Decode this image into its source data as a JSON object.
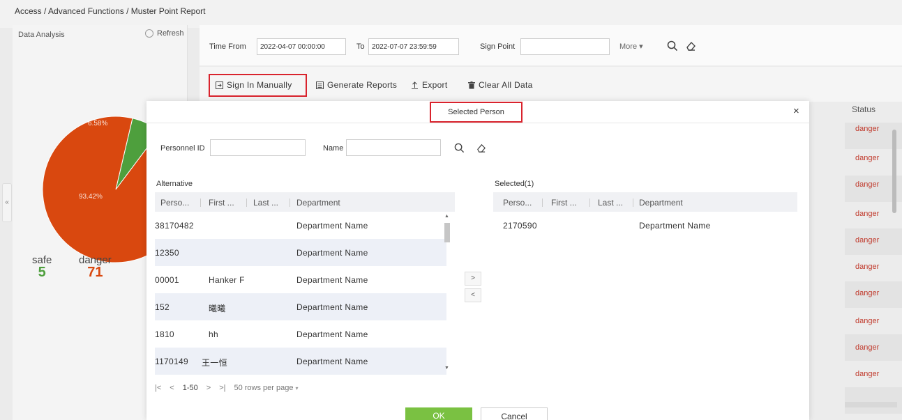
{
  "breadcrumb": "Access / Advanced Functions / Muster Point Report",
  "left_panel": {
    "title": "Data Analysis",
    "refresh_label": "Refresh",
    "pie": {
      "slices": [
        {
          "label": "6.58%",
          "value": 6.58,
          "color": "#4e9f3d"
        },
        {
          "label": "93.42%",
          "value": 93.42,
          "color": "#d9480f"
        }
      ]
    },
    "legend": [
      {
        "label": "safe",
        "value": "5",
        "color": "#4e9f3d"
      },
      {
        "label": "danger",
        "value": "71",
        "color": "#d9480f"
      }
    ],
    "collapse_glyph": "«"
  },
  "filters": {
    "time_from_label": "Time From",
    "time_from_value": "2022-04-07 00:00:00",
    "to_label": "To",
    "to_value": "2022-07-07 23:59:59",
    "sign_point_label": "Sign Point",
    "sign_point_value": "",
    "more_label": "More ▾"
  },
  "toolbar": {
    "sign_in_label": "Sign In Manually",
    "generate_label": "Generate Reports",
    "export_label": "Export",
    "clear_label": "Clear All Data"
  },
  "status_column": {
    "header": "Status",
    "values": [
      "danger",
      "danger",
      "danger",
      "danger",
      "danger",
      "danger",
      "danger",
      "danger",
      "danger",
      "danger"
    ]
  },
  "dialog": {
    "title": "Selected Person",
    "close_glyph": "×",
    "personnel_id_label": "Personnel ID",
    "personnel_id_value": "",
    "name_label": "Name",
    "name_value": "",
    "alternative_label": "Alternative",
    "selected_label": "Selected(1)",
    "columns": [
      "Perso...",
      "First ...",
      "Last ...",
      "Department"
    ],
    "alternative_rows": [
      {
        "id": "38170482",
        "first": "",
        "last": "",
        "dept": "Department Name"
      },
      {
        "id": "12350",
        "first": "",
        "last": "",
        "dept": "Department Name"
      },
      {
        "id": "00001",
        "first": "Hanker F",
        "last": "",
        "dept": "Department Name"
      },
      {
        "id": "152",
        "first": "曦曦",
        "last": "",
        "dept": "Department Name"
      },
      {
        "id": "1810",
        "first": "hh",
        "last": "",
        "dept": "Department Name"
      },
      {
        "id": "1170149",
        "first": "王一恒",
        "last": "",
        "dept": "Department Name"
      }
    ],
    "selected_rows": [
      {
        "id": "2170590",
        "first": "",
        "last": "",
        "dept": "Department Name"
      }
    ],
    "move_right": ">",
    "move_left": "<",
    "pager": {
      "first": "|<",
      "prev": "<",
      "range": "1-50",
      "next": ">",
      "last": ">|",
      "per_page": "50 rows per page",
      "per_page_caret": "▾"
    },
    "ok_label": "OK",
    "cancel_label": "Cancel"
  }
}
